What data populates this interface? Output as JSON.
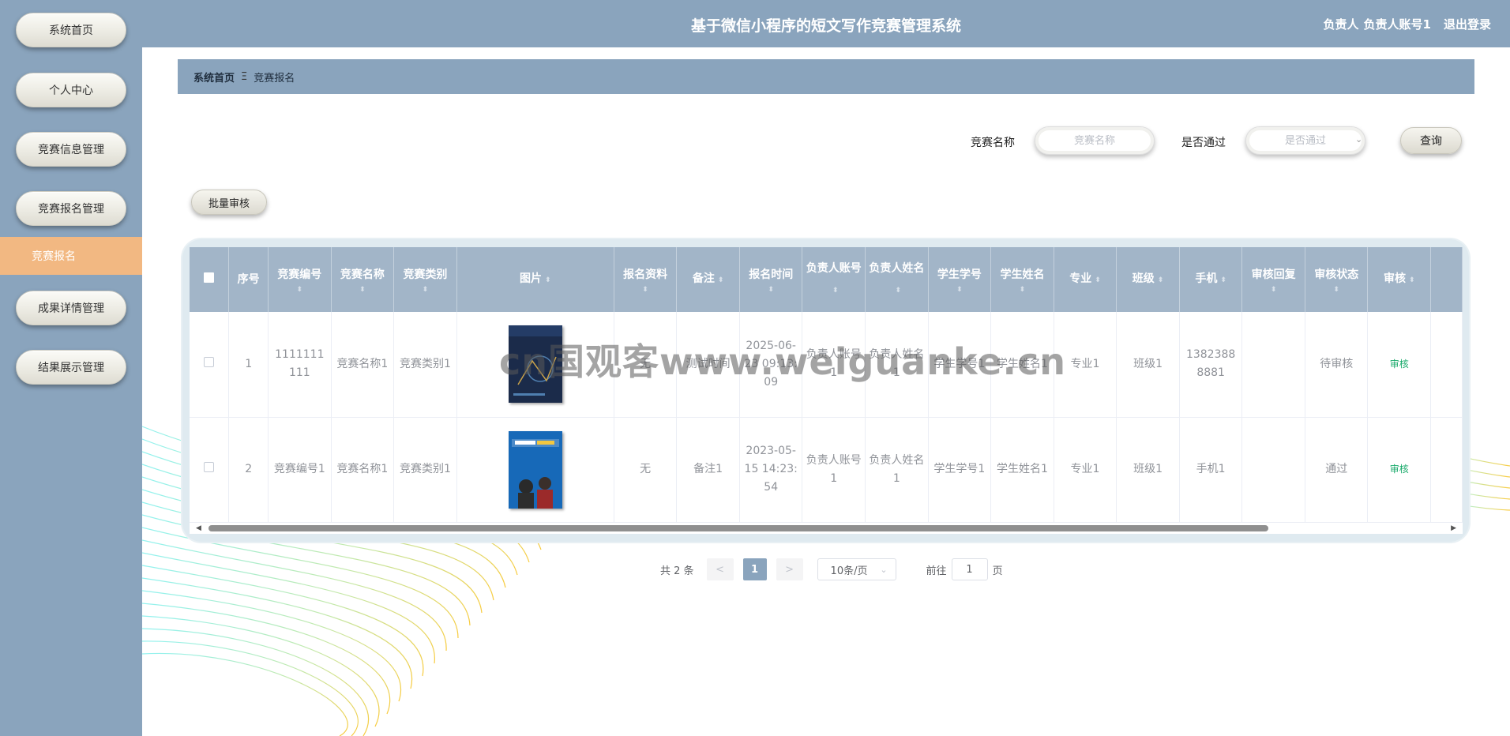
{
  "header": {
    "title": "基于微信小程序的短文写作竞赛管理系统",
    "role": "负责人",
    "account": "负责人账号1",
    "logout": "退出登录"
  },
  "sidebar": {
    "items": [
      {
        "label": "系统首页"
      },
      {
        "label": "个人中心"
      },
      {
        "label": "竞赛信息管理"
      },
      {
        "label": "竞赛报名管理"
      },
      {
        "label": "成果详情管理"
      },
      {
        "label": "结果展示管理"
      }
    ],
    "active_sub": "竞赛报名"
  },
  "breadcrumb": {
    "home": "系统首页",
    "separator": "Ξ",
    "current": "竞赛报名"
  },
  "search": {
    "name_label": "竞赛名称",
    "name_placeholder": "竞赛名称",
    "pass_label": "是否通过",
    "pass_placeholder": "是否通过",
    "query": "查询"
  },
  "toolbar": {
    "batch_audit": "批量审核"
  },
  "table": {
    "headers": [
      "序号",
      "竞赛编号",
      "竞赛名称",
      "竞赛类别",
      "图片",
      "报名资料",
      "备注",
      "报名时间",
      "负责人账号",
      "负责人姓名",
      "学生学号",
      "学生姓名",
      "专业",
      "班级",
      "手机",
      "审核回复",
      "审核状态",
      "审核"
    ],
    "rows": [
      {
        "cells": [
          "1",
          "1111111111",
          "竞赛名称1",
          "竞赛类别1",
          "",
          "无",
          "测试时间",
          "2025-06-23 09:13:09",
          "负责人账号1",
          "负责人姓名1",
          "学生学号1",
          "学生姓名1",
          "专业1",
          "班级1",
          "13823888881",
          "",
          "待审核",
          "审核"
        ]
      },
      {
        "cells": [
          "2",
          "竞赛编号1",
          "竞赛名称1",
          "竞赛类别1",
          "",
          "无",
          "备注1",
          "2023-05-15 14:23:54",
          "负责人账号1",
          "负责人姓名1",
          "学生学号1",
          "学生姓名1",
          "专业1",
          "班级1",
          "手机1",
          "",
          "通过",
          "审核"
        ]
      }
    ]
  },
  "pagination": {
    "total": "共 2 条",
    "prev": "<",
    "current": "1",
    "next": ">",
    "page_size": "10条/页",
    "goto_prefix": "前往",
    "goto_value": "1",
    "goto_suffix": "页"
  },
  "watermark": "cn国观客www.weiguanke.cn",
  "colors": {
    "primary": "#8aa4bd",
    "active_menu": "#f2b882",
    "table_header": "#a2b5c8",
    "link": "#1aaa6b"
  }
}
